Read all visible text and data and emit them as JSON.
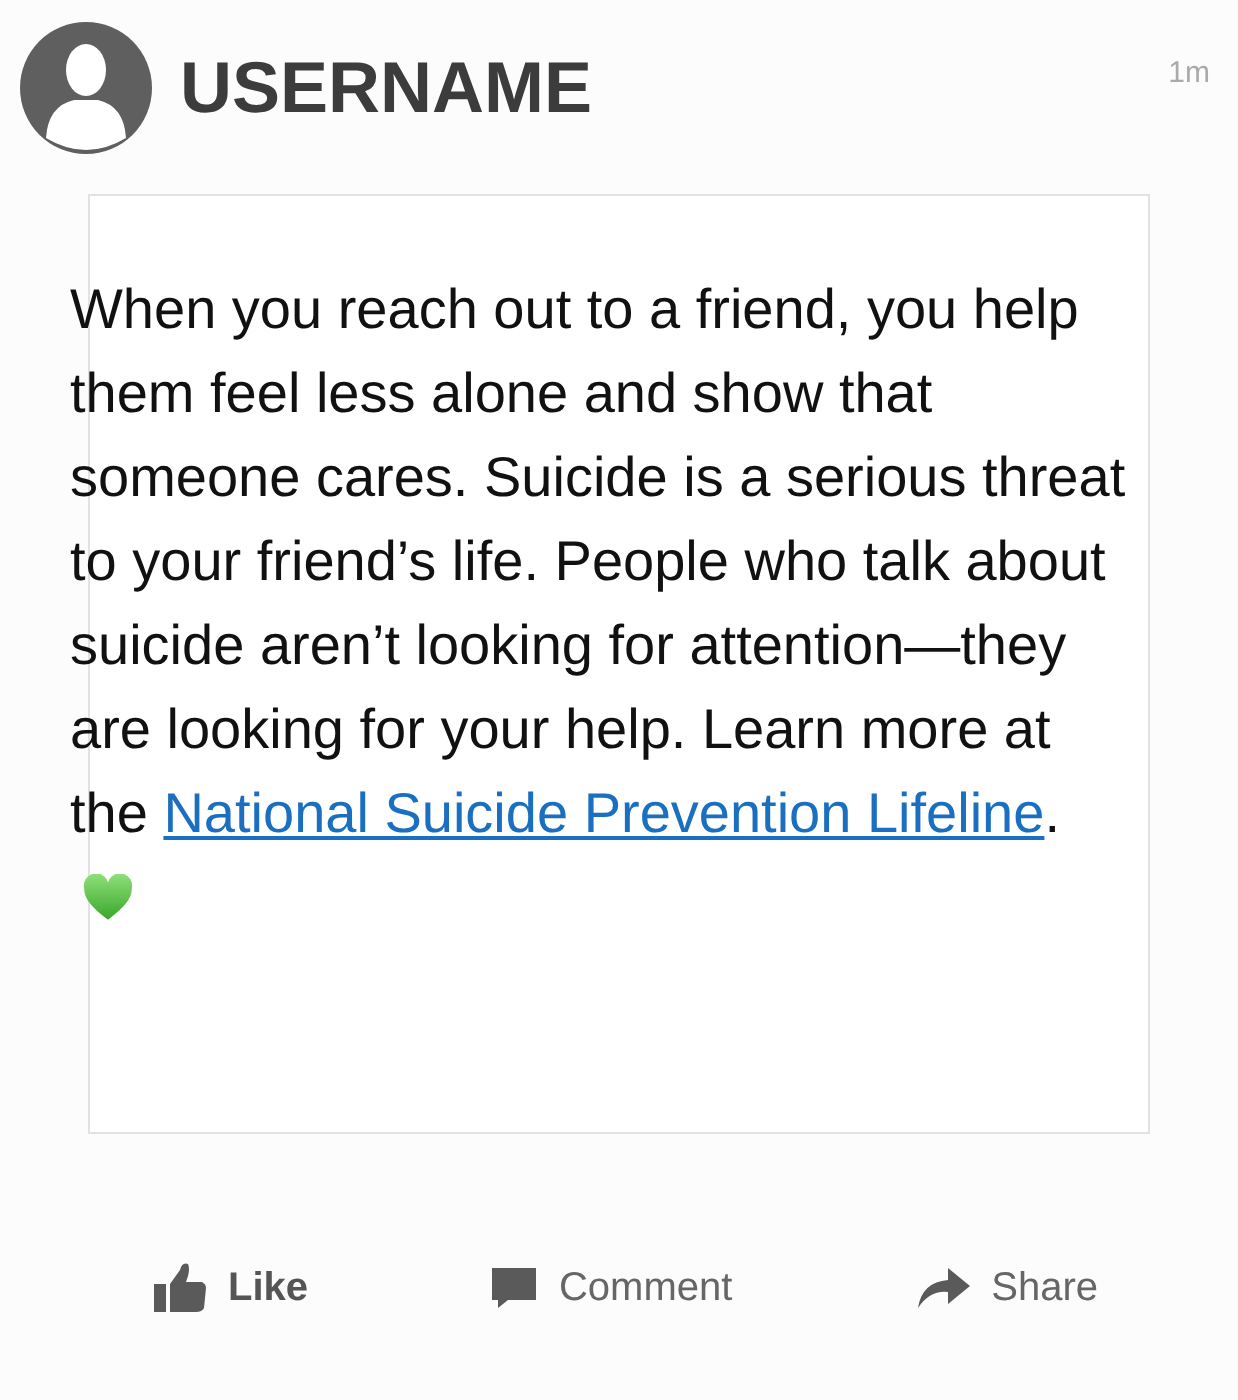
{
  "post": {
    "username": "USERNAME",
    "time": "1m",
    "text_before": "When you reach out to a friend, you help them feel less alone and show that someone cares. Suicide is a serious threat to your friend’s life. People who talk about suicide aren’t looking for attention—they are looking for your help. Learn more at the ",
    "link": "National Suicide Prevention Lifeline",
    "text_after": "."
  },
  "actions": [
    {
      "kind": "like",
      "label": "Like"
    },
    {
      "kind": "comment",
      "label": "Comment"
    },
    {
      "kind": "share",
      "label": "Share"
    }
  ]
}
